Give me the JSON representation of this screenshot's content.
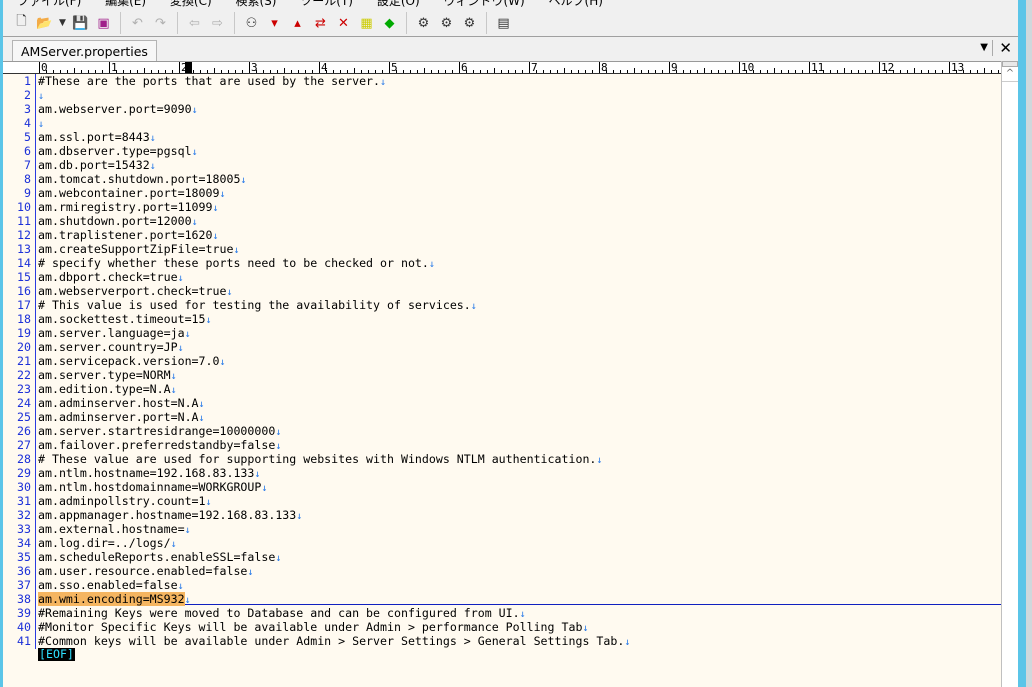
{
  "menu": [
    "ファイル(F)",
    "編集(E)",
    "変換(C)",
    "検索(S)",
    "ツール(T)",
    "設定(O)",
    "ウィンドウ(W)",
    "ヘルプ(H)"
  ],
  "tab": {
    "label": "AMServer.properties"
  },
  "ruler": [
    "0",
    "1",
    "2",
    "3",
    "4",
    "5",
    "6",
    "7",
    "8",
    "9",
    "10",
    "11",
    "12",
    "13"
  ],
  "eof": "[EOF]",
  "highlighted_line": 38,
  "lines": [
    "#These are the ports that are used by the server.",
    "",
    "am.webserver.port=9090",
    "",
    "am.ssl.port=8443",
    "am.dbserver.type=pgsql",
    "am.db.port=15432",
    "am.tomcat.shutdown.port=18005",
    "am.webcontainer.port=18009",
    "am.rmiregistry.port=11099",
    "am.shutdown.port=12000",
    "am.traplistener.port=1620",
    "am.createSupportZipFile=true",
    "# specify whether these ports need to be checked or not.",
    "am.dbport.check=true",
    "am.webserverport.check=true",
    "# This value is used for testing the availability of services.",
    "am.sockettest.timeout=15",
    "am.server.language=ja",
    "am.server.country=JP",
    "am.servicepack.version=7.0",
    "am.server.type=NORM",
    "am.edition.type=N.A",
    "am.adminserver.host=N.A",
    "am.adminserver.port=N.A",
    "am.server.startresidrange=10000000",
    "am.failover.preferredstandby=false",
    "# These value are used for supporting websites with Windows NTLM authentication.",
    "am.ntlm.hostname=192.168.83.133",
    "am.ntlm.hostdomainname=WORKGROUP",
    "am.adminpollstry.count=1",
    "am.appmanager.hostname=192.168.83.133",
    "am.external.hostname=",
    "am.log.dir=../logs/",
    "am.scheduleReports.enableSSL=false",
    "am.user.resource.enabled=false",
    "am.sso.enabled=false",
    "am.wmi.encoding=MS932",
    "#Remaining Keys were moved to Database and can be configured from UI.",
    "#Monitor Specific Keys will be available under Admin > performance Polling Tab",
    "#Common keys will be available under Admin > Server Settings > General Settings Tab."
  ]
}
